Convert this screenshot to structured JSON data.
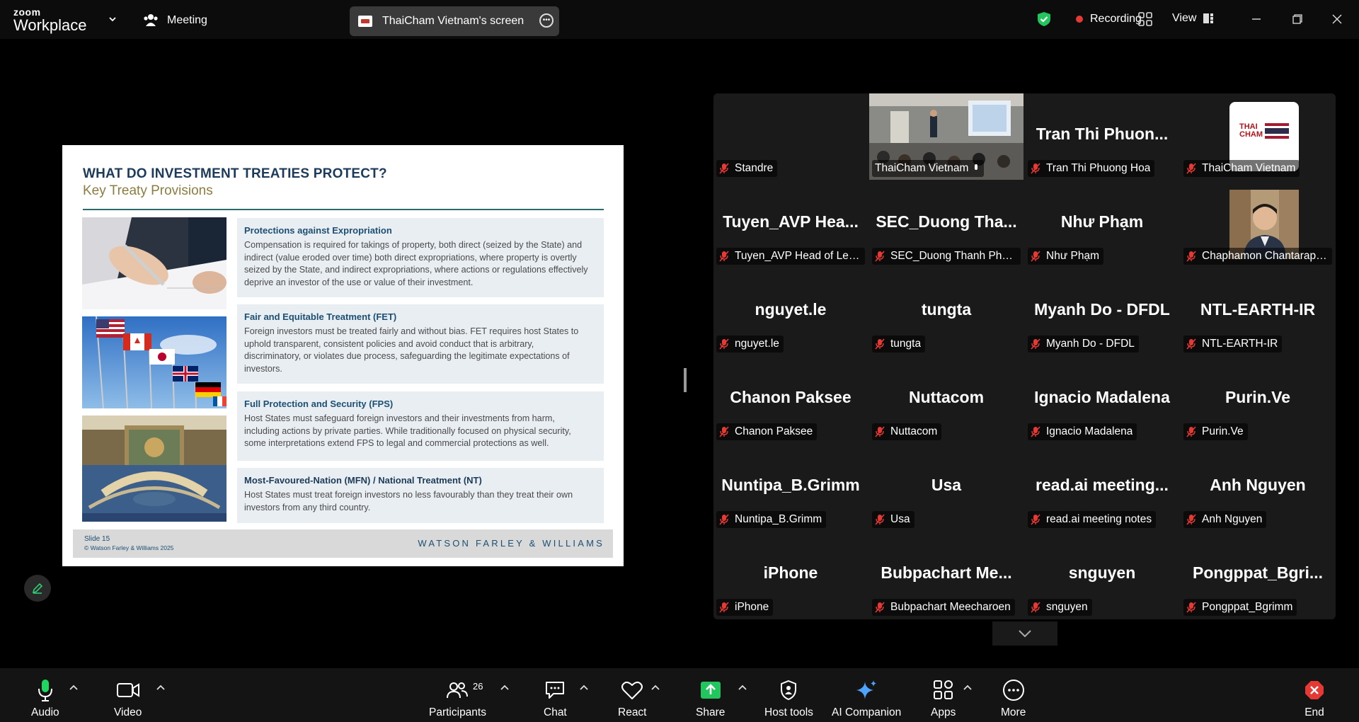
{
  "app": {
    "brand_top": "zoom",
    "brand_bottom": "Workplace",
    "meeting_label": "Meeting",
    "share_label": "ThaiCham Vietnam's screen",
    "recording_label": "Recording",
    "view_label": "View"
  },
  "slide": {
    "title": "WHAT DO INVESTMENT TREATIES PROTECT?",
    "subtitle": "Key Treaty Provisions",
    "sections": [
      {
        "heading": "Protections against Expropriation",
        "body": "Compensation is required for takings of property, both direct (seized by the State) and indirect (value eroded over time) both direct expropriations, where property is overtly seized by the State, and indirect expropriations, where actions or regulations effectively deprive an investor of the use or value of their investment."
      },
      {
        "heading": "Fair and Equitable Treatment (FET)",
        "body": "Foreign investors must be treated fairly and without bias. FET requires host States to uphold transparent, consistent policies and avoid conduct that is arbitrary, discriminatory, or violates due process, safeguarding the legitimate expectations of investors."
      },
      {
        "heading": "Full Protection and Security (FPS)",
        "body": "Host States must safeguard foreign investors and their investments from harm, including actions by private parties. While traditionally focused on physical security, some interpretations extend FPS to legal and commercial protections as well."
      },
      {
        "heading": "Most-Favoured-Nation (MFN) / National Treatment (NT)",
        "body": "Host States must treat foreign investors no less favourably than they treat their own investors from any third country."
      }
    ],
    "slide_number": "Slide 15",
    "copyright": "© Watson Farley & Williams 2025",
    "firm": "WATSON FARLEY & WILLIAMS"
  },
  "participants": [
    {
      "big": "",
      "label": "Standre"
    },
    {
      "big": "",
      "label": "ThaiCham Vietnam"
    },
    {
      "big": "Tran Thi Phuon...",
      "label": "Tran Thi Phuong Hoa"
    },
    {
      "big": "",
      "label": "ThaiCham Vietnam",
      "logo_text": "THAI CHAM"
    },
    {
      "big": "Tuyen_AVP Hea...",
      "label": "Tuyen_AVP Head of Legal..."
    },
    {
      "big": "SEC_Duong Tha...",
      "label": "SEC_Duong Thanh Phuc (..."
    },
    {
      "big": "Như Phạm",
      "label": "Như Phạm"
    },
    {
      "big": "",
      "label": "Chaphamon Chantarapon..."
    },
    {
      "big": "nguyet.le",
      "label": "nguyet.le"
    },
    {
      "big": "tungta",
      "label": "tungta"
    },
    {
      "big": "Myanh Do - DFDL",
      "label": "Myanh Do - DFDL"
    },
    {
      "big": "NTL-EARTH-IR",
      "label": "NTL-EARTH-IR"
    },
    {
      "big": "Chanon Paksee",
      "label": "Chanon Paksee"
    },
    {
      "big": "Nuttacom",
      "label": "Nuttacom"
    },
    {
      "big": "Ignacio Madalena",
      "label": "Ignacio Madalena"
    },
    {
      "big": "Purin.Ve",
      "label": "Purin.Ve"
    },
    {
      "big": "Nuntipa_B.Grimm",
      "label": "Nuntipa_B.Grimm"
    },
    {
      "big": "Usa",
      "label": "Usa"
    },
    {
      "big": "read.ai  meeting...",
      "label": "read.ai meeting notes"
    },
    {
      "big": "Anh Nguyen",
      "label": "Anh Nguyen"
    },
    {
      "big": "iPhone",
      "label": "iPhone"
    },
    {
      "big": "Bubpachart  Me...",
      "label": "Bubpachart Meecharoen"
    },
    {
      "big": "snguyen",
      "label": "snguyen"
    },
    {
      "big": "Pongppat_Bgri...",
      "label": "Pongppat_Bgrimm"
    }
  ],
  "toolbar": {
    "audio": "Audio",
    "video": "Video",
    "participants": "Participants",
    "participant_count": "26",
    "chat": "Chat",
    "react": "React",
    "share": "Share",
    "host_tools": "Host tools",
    "ai_companion": "AI Companion",
    "apps": "Apps",
    "more": "More",
    "end": "End"
  },
  "colors": {
    "accent_green": "#1ed760",
    "share_green": "#22c55e",
    "end_red": "#e53935",
    "mute_red": "#e53935"
  }
}
